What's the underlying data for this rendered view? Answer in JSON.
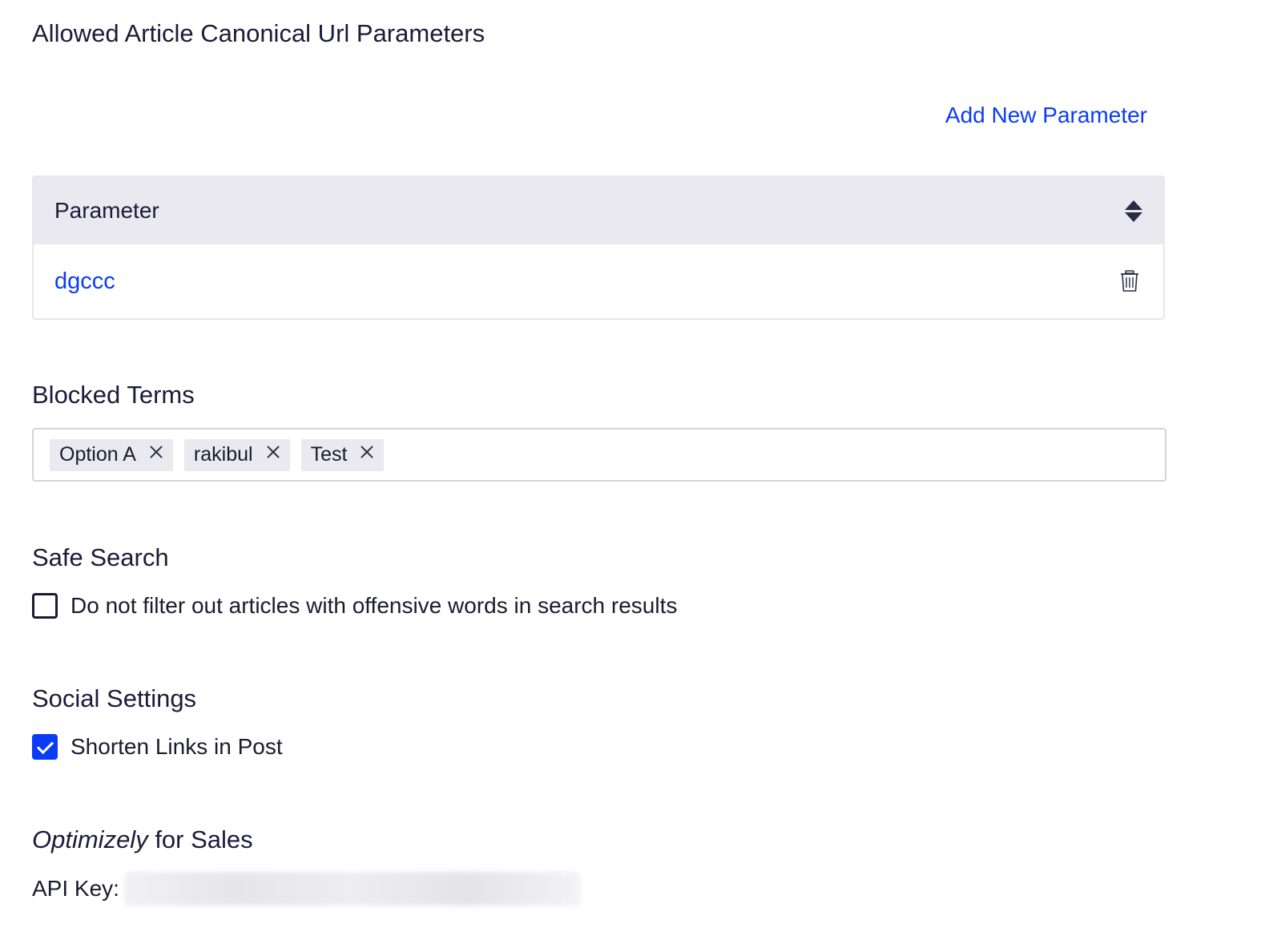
{
  "canonical": {
    "title": "Allowed Article Canonical Url Parameters",
    "add_button_label": "Add New Parameter",
    "table": {
      "column_header": "Parameter",
      "rows": [
        {
          "value": "dgccc"
        }
      ]
    }
  },
  "blocked_terms": {
    "title": "Blocked Terms",
    "tags": [
      "Option A",
      "rakibul",
      "Test"
    ]
  },
  "safe_search": {
    "title": "Safe Search",
    "checkbox_label": "Do not filter out articles with offensive words in search results",
    "checked": false
  },
  "social_settings": {
    "title": "Social Settings",
    "checkbox_label": "Shorten Links in Post",
    "checked": true
  },
  "optimizely": {
    "title_brand": "Optimizely",
    "title_rest": " for Sales",
    "api_key_label": "API Key:"
  },
  "colors": {
    "accent": "#0b3cf5",
    "header_bg": "#e9e9ef",
    "text": "#1b1b2f"
  }
}
